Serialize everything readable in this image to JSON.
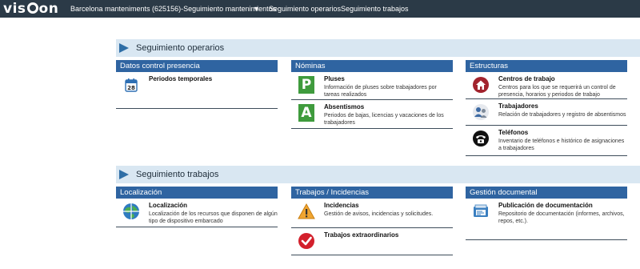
{
  "topbar": {
    "brand": "vision",
    "context_label": "Barcelona manteniments (625156)-Seguimiento mantenimientos",
    "caret_icon": "caret-down-icon",
    "nav_items": [
      "Seguimiento operarios",
      "Seguimiento trabajos"
    ]
  },
  "sections": [
    {
      "title": "Seguimiento operarios",
      "columns": [
        {
          "header": "Datos control presencia",
          "items": [
            {
              "icon": "calendar-icon",
              "title": "Periodos temporales",
              "desc": ""
            }
          ]
        },
        {
          "header": "Nóminas",
          "items": [
            {
              "icon": "letter-p-icon",
              "title": "Pluses",
              "desc": "Información de pluses sobre trabajadores por tareas realizados"
            },
            {
              "icon": "letter-a-icon",
              "title": "Absentismos",
              "desc": "Periodos de bajas, licencias y vacaciones de los trabajadores"
            }
          ]
        },
        {
          "header": "Estructuras",
          "items": [
            {
              "icon": "workplace-icon",
              "title": "Centros de trabajo",
              "desc": "Centros para los que se requerirá un control de presencia, horarios y periodos de trabajo"
            },
            {
              "icon": "workers-icon",
              "title": "Trabajadores",
              "desc": "Relación de trabajadores y registro de absentismos"
            },
            {
              "icon": "telephone-icon",
              "title": "Teléfonos",
              "desc": "Inventario de teléfonos e histórico de asignaciones a trabajadores"
            }
          ]
        }
      ]
    },
    {
      "title": "Seguimiento trabajos",
      "columns": [
        {
          "header": "Localización",
          "items": [
            {
              "icon": "globe-icon",
              "title": "Localización",
              "desc": "Localización de los recursos que disponen de algún tipo de dispositivo embarcado"
            }
          ]
        },
        {
          "header": "Trabajos / Incidencias",
          "items": [
            {
              "icon": "warning-icon",
              "title": "Incidencias",
              "desc": "Gestión de avisos, incidencias y solicitudes."
            },
            {
              "icon": "checkmark-icon",
              "title": "Trabajos extraordinarios",
              "desc": ""
            }
          ]
        },
        {
          "header": "Gestión documental",
          "items": [
            {
              "icon": "documents-icon",
              "title": "Publicación de documentación",
              "desc": "Repositorio de documentación (informes, archivos, repos, etc.)."
            }
          ]
        }
      ]
    }
  ],
  "colors": {
    "topbar_bg": "#2b3a47",
    "section_bar_bg": "#d9e7f2",
    "column_header_bg": "#2f64a1",
    "accent_arrow": "#2f6ea6",
    "letter_icon_green": "#3f9b3d"
  }
}
